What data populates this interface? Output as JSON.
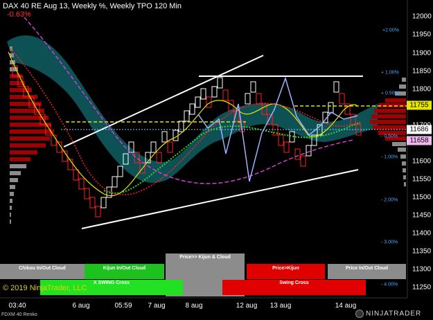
{
  "header": {
    "title": "DAX 40 RE Aug 13, Weekly %, Weekly TPO 120 Min",
    "change": "-0.63%"
  },
  "colors": {
    "background": "#000000",
    "cloud": "#0f5a5e",
    "up_renko": "#ffffff",
    "down_renko": "#ff2020",
    "ma_yellow": "#e6e600",
    "ma_green": "#37d62e",
    "ma_red": "#ff2020",
    "ma_magenta": "#d040d0",
    "ma_blue": "#9fb4ff",
    "pct_text": "#4aa8ff"
  },
  "price_axis": {
    "ticks": [
      "12000",
      "11950",
      "11900",
      "11850",
      "11800",
      "11750",
      "11700",
      "11650",
      "11600",
      "11550",
      "11500",
      "11450",
      "11400",
      "11350",
      "11300",
      "11250"
    ]
  },
  "percent_levels": [
    "+2.00%",
    "+ 1.00%",
    "+ 0.50%",
    "- 0.50%",
    "- 1.00%",
    "- 2.00%",
    "- 3.00%",
    "- 4.00%"
  ],
  "price_markers": [
    {
      "label": "11755",
      "color": "#e6e600"
    },
    {
      "label": "11686",
      "color": "#ffffff"
    },
    {
      "label": "11658",
      "color": "#f0b7f0"
    }
  ],
  "time_axis": {
    "ticks": [
      "03:40",
      "6 aug",
      "05:59",
      "7 aug",
      "8 aug",
      "12 aug",
      "13 aug",
      "14 aug"
    ]
  },
  "signals": {
    "chikou": "Chikou In/Out Cloud",
    "kijun_cloud": "Kijun In/Out Cloud",
    "price_kijun_cloud": "Price>> Kijun & Cloud",
    "price_kijun": "Price>Kijun",
    "price_cloud": "Price In/Out Cloud",
    "x_swing": "X SWING Cross",
    "swing": "Swing Cross"
  },
  "footer": {
    "copyright": "© 2019 NinjaTrader, LLC",
    "instrument": "FDXM 40 Renko",
    "brand": "NINJATRADER"
  }
}
